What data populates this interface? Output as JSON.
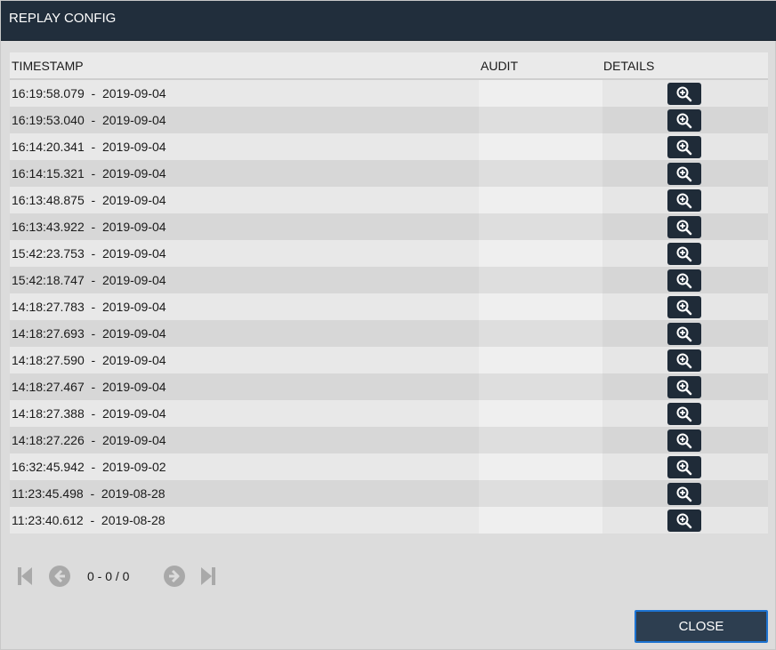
{
  "dialog": {
    "title": "REPLAY CONFIG"
  },
  "table": {
    "columns": {
      "timestamp": "TIMESTAMP",
      "audit": "AUDIT",
      "details": "DETAILS"
    },
    "rows": [
      {
        "timestamp": "16:19:58.079  -  2019-09-04",
        "audit": "",
        "details_icon": "zoom-in-icon"
      },
      {
        "timestamp": "16:19:53.040  -  2019-09-04",
        "audit": "",
        "details_icon": "zoom-in-icon"
      },
      {
        "timestamp": "16:14:20.341  -  2019-09-04",
        "audit": "",
        "details_icon": "zoom-in-icon"
      },
      {
        "timestamp": "16:14:15.321  -  2019-09-04",
        "audit": "",
        "details_icon": "zoom-in-icon"
      },
      {
        "timestamp": "16:13:48.875  -  2019-09-04",
        "audit": "",
        "details_icon": "zoom-in-icon"
      },
      {
        "timestamp": "16:13:43.922  -  2019-09-04",
        "audit": "",
        "details_icon": "zoom-in-icon"
      },
      {
        "timestamp": "15:42:23.753  -  2019-09-04",
        "audit": "",
        "details_icon": "zoom-in-icon"
      },
      {
        "timestamp": "15:42:18.747  -  2019-09-04",
        "audit": "",
        "details_icon": "zoom-in-icon"
      },
      {
        "timestamp": "14:18:27.783  -  2019-09-04",
        "audit": "",
        "details_icon": "zoom-in-icon"
      },
      {
        "timestamp": "14:18:27.693  -  2019-09-04",
        "audit": "",
        "details_icon": "zoom-in-icon"
      },
      {
        "timestamp": "14:18:27.590  -  2019-09-04",
        "audit": "",
        "details_icon": "zoom-in-icon"
      },
      {
        "timestamp": "14:18:27.467  -  2019-09-04",
        "audit": "",
        "details_icon": "zoom-in-icon"
      },
      {
        "timestamp": "14:18:27.388  -  2019-09-04",
        "audit": "",
        "details_icon": "zoom-in-icon"
      },
      {
        "timestamp": "14:18:27.226  -  2019-09-04",
        "audit": "",
        "details_icon": "zoom-in-icon"
      },
      {
        "timestamp": "16:32:45.942  -  2019-09-02",
        "audit": "",
        "details_icon": "zoom-in-icon"
      },
      {
        "timestamp": "11:23:45.498  -  2019-08-28",
        "audit": "",
        "details_icon": "zoom-in-icon"
      },
      {
        "timestamp": "11:23:40.612  -  2019-08-28",
        "audit": "",
        "details_icon": "zoom-in-icon"
      }
    ]
  },
  "pagination": {
    "info": "0 - 0 / 0",
    "icons": {
      "first": "first-page-icon",
      "prev": "prev-page-icon",
      "next": "next-page-icon",
      "last": "last-page-icon"
    }
  },
  "footer": {
    "close_label": "CLOSE"
  },
  "colors": {
    "titlebar_bg": "#212e3c",
    "button_bg": "#1f2b38",
    "close_bg": "#2d3e50",
    "close_border": "#1d73d1",
    "pager_icon": "#a9a9a9"
  }
}
